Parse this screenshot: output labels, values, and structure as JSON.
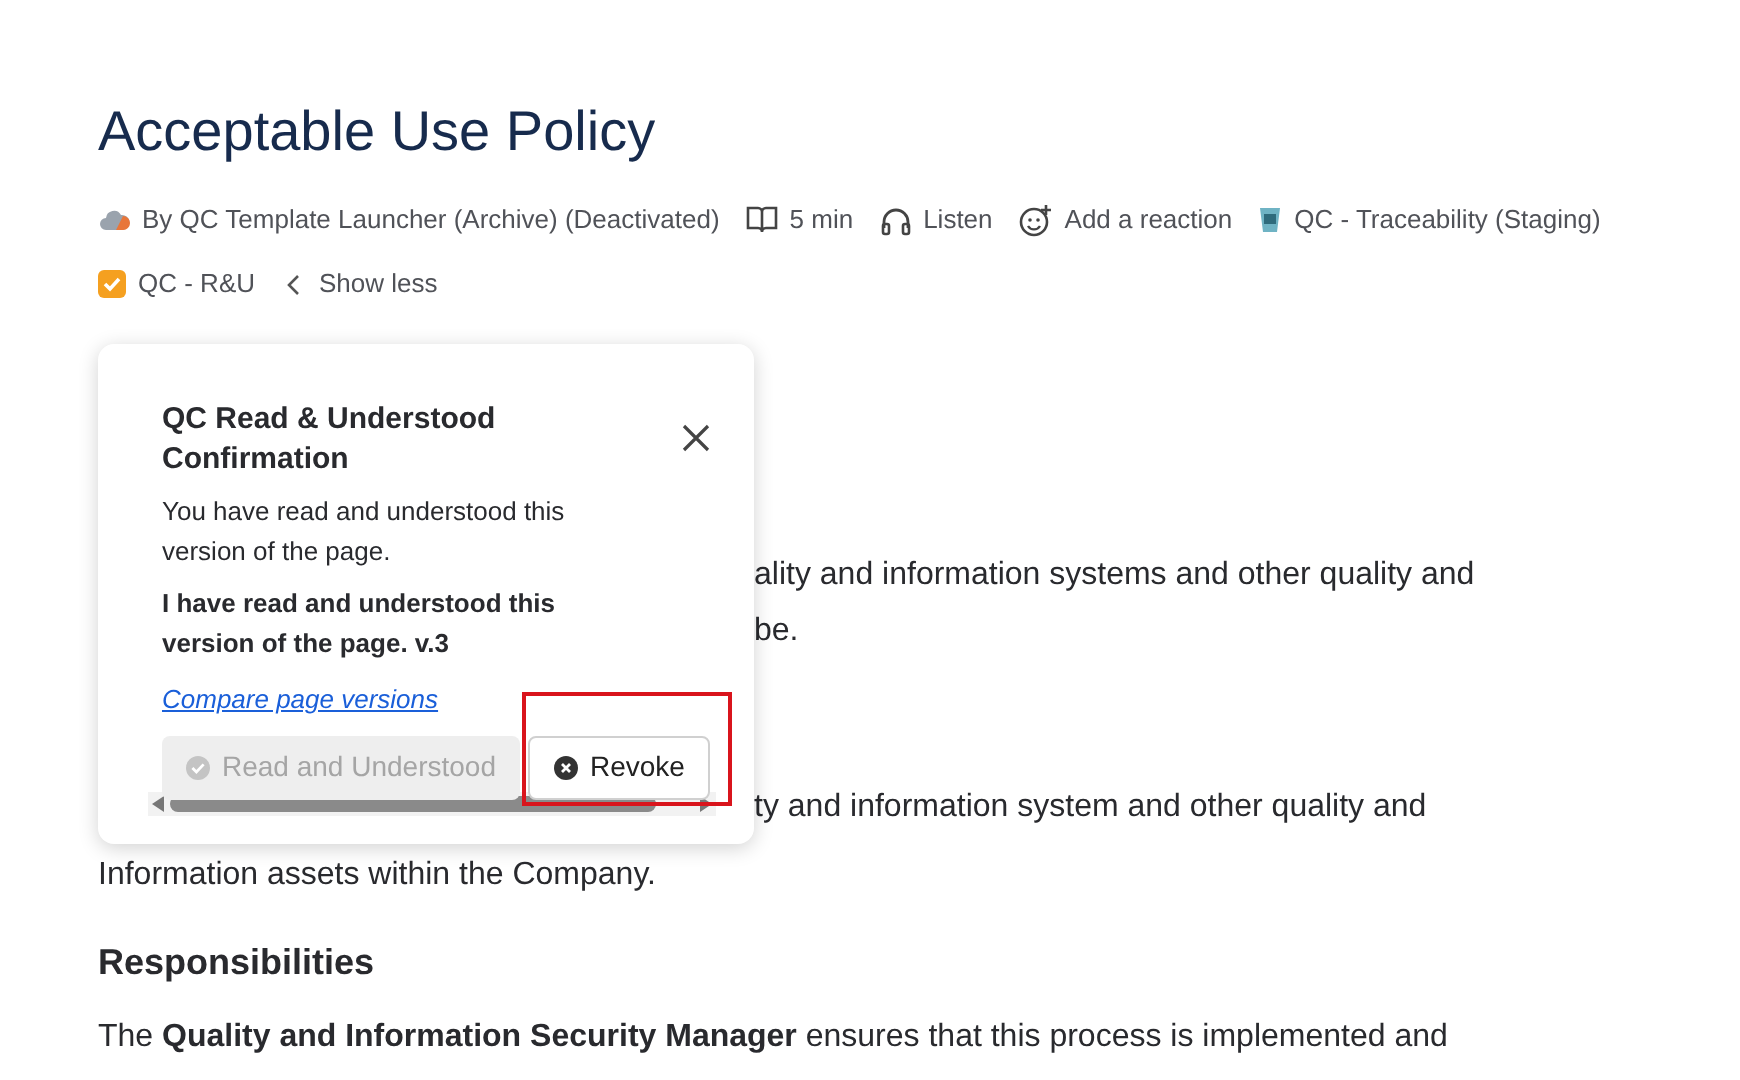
{
  "page": {
    "title": "Acceptable Use Policy",
    "byline": [
      {
        "kind": "author",
        "text": "By QC Template Launcher (Archive) (Deactivated)"
      },
      {
        "kind": "read_time",
        "text": "5 min"
      },
      {
        "kind": "listen",
        "text": "Listen"
      },
      {
        "kind": "reaction",
        "text": "Add a reaction"
      },
      {
        "kind": "app",
        "text": "QC - Traceability (Staging)"
      },
      {
        "kind": "check_app",
        "text": "QC - R&U"
      },
      {
        "kind": "toggle",
        "text": "Show less"
      }
    ],
    "body_fragments": [
      "ality and information systems and other quality and",
      "be.",
      "ty and information system and other quality and",
      "Information assets within the Company."
    ],
    "heading": "Responsibilities",
    "paragraph": "The **Quality and Information Security Manager** ensures that this process is implemented and"
  },
  "popover": {
    "title": "QC Read & Understood Confirmation",
    "message": "You have read and understood this version of the page.",
    "statement": "I have read and understood this version of the page. v.3",
    "link": "Compare page versions",
    "buttons": [
      {
        "kind": "confirm",
        "label": "Read and Understood",
        "disabled": true
      },
      {
        "kind": "revoke",
        "label": "Revoke",
        "disabled": false,
        "highlighted": true
      }
    ]
  }
}
